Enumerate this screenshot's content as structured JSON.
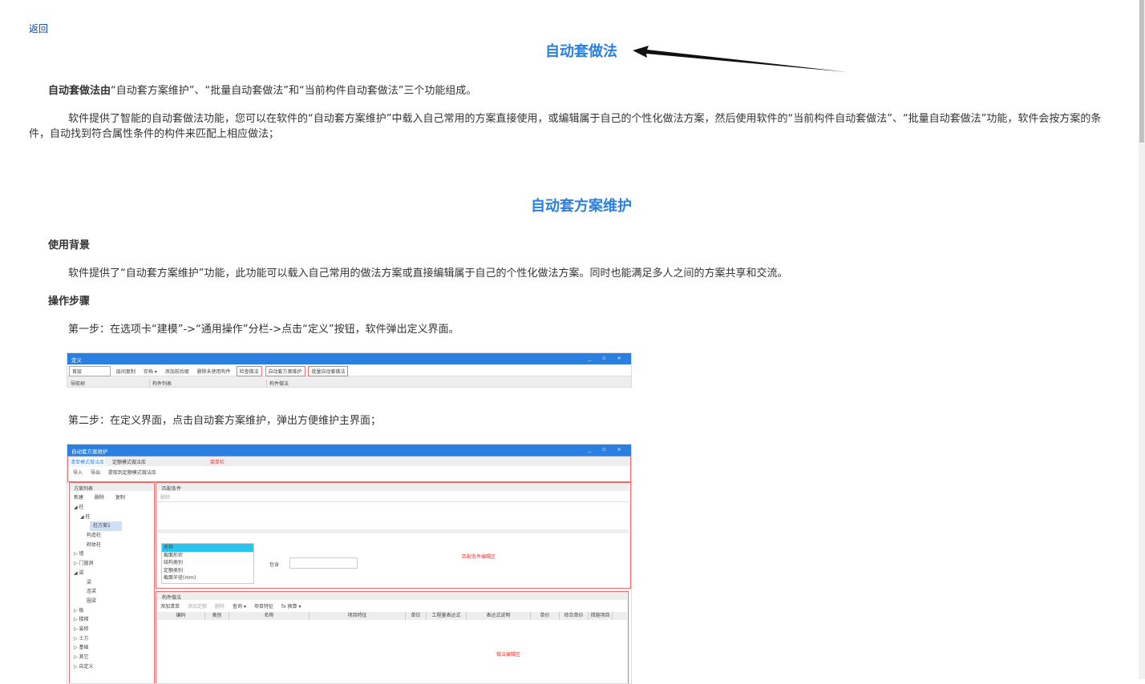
{
  "back_link": "返回",
  "title": "自动套做法",
  "intro": {
    "bold": "自动套做法由",
    "rest": "“自动套方案维护”、“批量自动套做法”和“当前构件自动套做法”三个功能组成。"
  },
  "para1": "软件提供了智能的自动套做法功能，您可以在软件的“自动套方案维护”中载入自己常用的方案直接使用，或编辑属于自己的个性化做法方案，然后使用软件的“当前构件自动套做法”、“批量自动套做法”功能，软件会按方案的条件，自动找到符合属性条件的构件来匹配上相应做法；",
  "section_title": "自动套方案维护",
  "bg_heading": "使用背景",
  "bg_text": "软件提供了“自动套方案维护”功能，此功能可以载入自己常用的做法方案或直接编辑属于自己的个性化做法方案。同时也能满足多人之间的方案共享和交流。",
  "steps_heading": "操作步骤",
  "step1": "第一步：在选项卡“建模”->“通用操作”分栏->点击“定义”按钮，软件弹出定义界面。",
  "step2": "第二步：在定义界面，点击自动套方案维护，弹出方便维护主界面；",
  "shot1": {
    "title": "定义",
    "window_controls": "_ ▫ ×",
    "floor": "首层",
    "tools": [
      "层间复制",
      "存档 ▾",
      "添加前后缀",
      "删除未使用构件",
      "检查做法",
      "自动套方案维护",
      "批量自动套做法"
    ],
    "panels": [
      "导航树",
      "构件列表",
      "构件做法"
    ]
  },
  "shot2": {
    "title": "自动套方案维护",
    "window_controls": "_ ▫ ×",
    "tabs": [
      "清单模式做法库",
      "定额模式做法库"
    ],
    "menu_label": "菜单栏",
    "tools": [
      "导入",
      "导出",
      "提取到定额模式做法库"
    ],
    "plan_list": "方案列表",
    "plan_tools": [
      "新建",
      "删除",
      "复制"
    ],
    "tree": [
      "◢ 柱",
      "◢ 柱",
      "柱方案1",
      "构造柱",
      "砌体柱",
      "▷ 墙",
      "▷ 门窗洞",
      "◢ 梁",
      "梁",
      "连梁",
      "圈梁",
      "▷ 板",
      "▷ 楼梯",
      "▷ 装修",
      "▷ 土方",
      "▷ 基础",
      "▷ 其它",
      "▷ 自定义"
    ],
    "match": "匹配条件",
    "delete": "删除",
    "attrs": [
      "名称",
      "截面形状",
      "结构类别",
      "定额类别",
      "截面半径(mm)"
    ],
    "contains": "包含",
    "match_area": "匹配条件编辑区",
    "method": "构件做法",
    "method_tools": [
      "添加清单",
      "添加定额",
      "删除",
      "查询 ▾",
      "项目特征",
      "fx 换算 ▾"
    ],
    "columns": [
      "编码",
      "类别",
      "名称",
      "项目特征",
      "单位",
      "工程量表达式",
      "表达式说明",
      "单价",
      "综合单价",
      "措施项目"
    ],
    "method_area": "做法编辑区"
  }
}
